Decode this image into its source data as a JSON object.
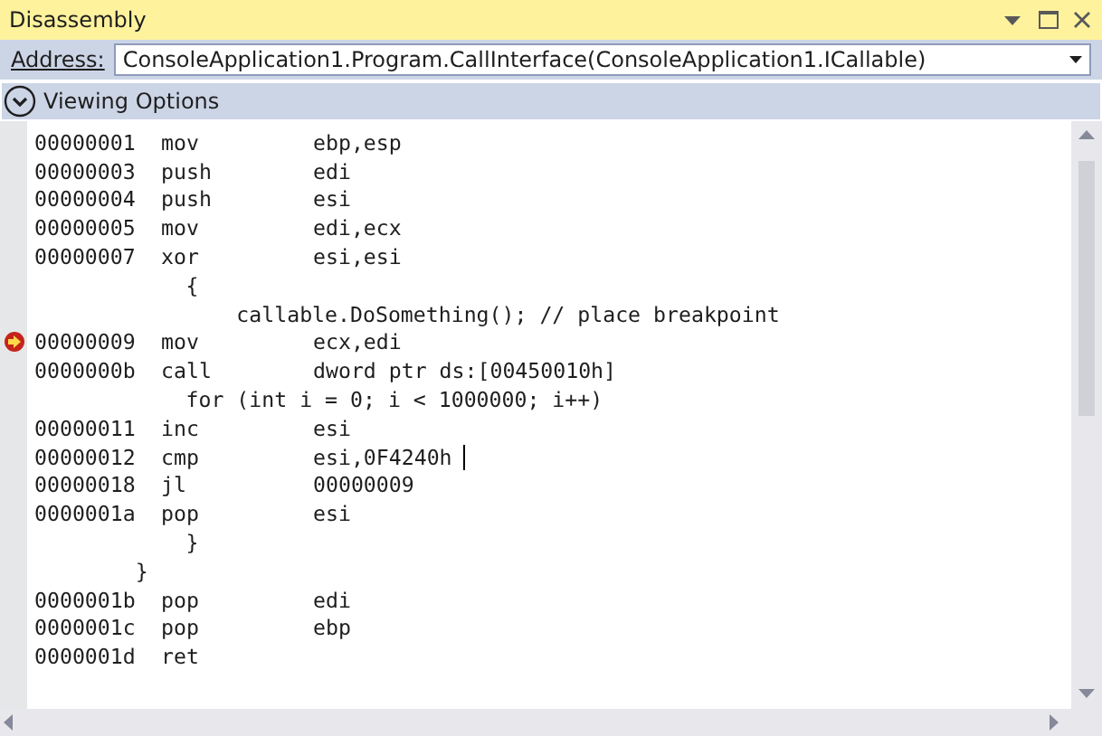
{
  "window": {
    "title": "Disassembly"
  },
  "address": {
    "label": "Address:",
    "value": "ConsoleApplication1.Program.CallInterface(ConsoleApplication1.ICallable)"
  },
  "viewing_options": {
    "label": "Viewing Options",
    "expanded": false
  },
  "lines": [
    {
      "kind": "asm",
      "address": "00000001",
      "mnemonic": "mov",
      "operands": "ebp,esp",
      "current": false,
      "caret": false
    },
    {
      "kind": "asm",
      "address": "00000003",
      "mnemonic": "push",
      "operands": "edi",
      "current": false,
      "caret": false
    },
    {
      "kind": "asm",
      "address": "00000004",
      "mnemonic": "push",
      "operands": "esi",
      "current": false,
      "caret": false
    },
    {
      "kind": "asm",
      "address": "00000005",
      "mnemonic": "mov",
      "operands": "edi,ecx",
      "current": false,
      "caret": false
    },
    {
      "kind": "asm",
      "address": "00000007",
      "mnemonic": "xor",
      "operands": "esi,esi",
      "current": false,
      "caret": false
    },
    {
      "kind": "source",
      "text": "            {"
    },
    {
      "kind": "source",
      "text": "                callable.DoSomething(); // place breakpoint"
    },
    {
      "kind": "asm",
      "address": "00000009",
      "mnemonic": "mov",
      "operands": "ecx,edi",
      "current": true,
      "caret": false
    },
    {
      "kind": "asm",
      "address": "0000000b",
      "mnemonic": "call",
      "operands": "dword ptr ds:[00450010h]",
      "current": false,
      "caret": false
    },
    {
      "kind": "source",
      "text": "            for (int i = 0; i < 1000000; i++)"
    },
    {
      "kind": "asm",
      "address": "00000011",
      "mnemonic": "inc",
      "operands": "esi",
      "current": false,
      "caret": false
    },
    {
      "kind": "asm",
      "address": "00000012",
      "mnemonic": "cmp",
      "operands": "esi,0F4240h",
      "current": false,
      "caret": true
    },
    {
      "kind": "asm",
      "address": "00000018",
      "mnemonic": "jl",
      "operands": "00000009",
      "current": false,
      "caret": false
    },
    {
      "kind": "asm",
      "address": "0000001a",
      "mnemonic": "pop",
      "operands": "esi",
      "current": false,
      "caret": false
    },
    {
      "kind": "source",
      "text": "            }"
    },
    {
      "kind": "source",
      "text": "        }"
    },
    {
      "kind": "asm",
      "address": "0000001b",
      "mnemonic": "pop",
      "operands": "edi",
      "current": false,
      "caret": false
    },
    {
      "kind": "asm",
      "address": "0000001c",
      "mnemonic": "pop",
      "operands": "ebp",
      "current": false,
      "caret": false
    },
    {
      "kind": "asm",
      "address": "0000001d",
      "mnemonic": "ret",
      "current": false,
      "caret": false
    }
  ]
}
